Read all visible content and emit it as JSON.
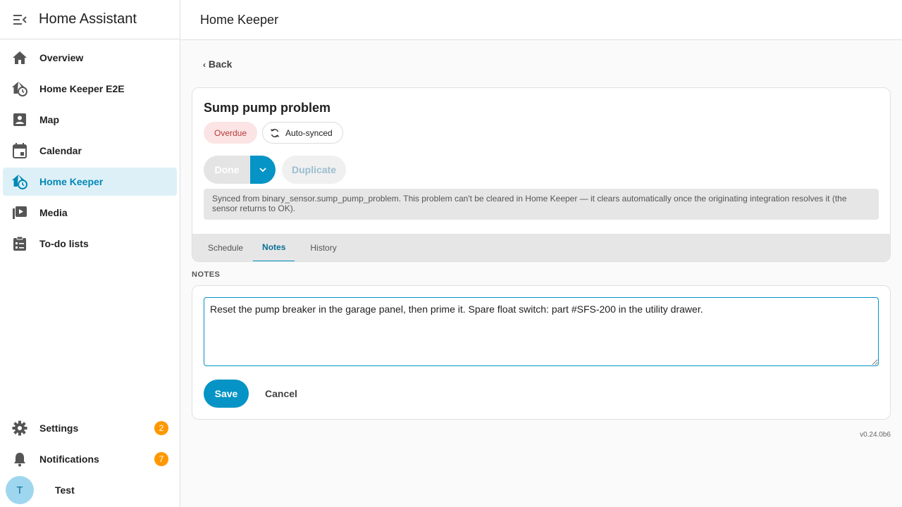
{
  "app": {
    "title": "Home Assistant"
  },
  "sidebar": {
    "items": [
      {
        "label": "Overview",
        "icon": "home-icon"
      },
      {
        "label": "Home Keeper E2E",
        "icon": "home-clock-icon"
      },
      {
        "label": "Map",
        "icon": "account-box-icon"
      },
      {
        "label": "Calendar",
        "icon": "calendar-icon"
      },
      {
        "label": "Home Keeper",
        "icon": "home-clock-icon",
        "active": true
      },
      {
        "label": "Media",
        "icon": "play-box-multiple-icon"
      },
      {
        "label": "To-do lists",
        "icon": "clipboard-list-icon"
      }
    ],
    "settings": {
      "label": "Settings",
      "badge": "2"
    },
    "notifications": {
      "label": "Notifications",
      "badge": "7"
    },
    "user": {
      "initial": "T",
      "name": "Test"
    }
  },
  "header": {
    "title": "Home Keeper"
  },
  "main": {
    "back_label": "Back",
    "task": {
      "title": "Sump pump problem",
      "status_chip": "Overdue",
      "sync_chip": "Auto-synced",
      "done_label": "Done",
      "duplicate_label": "Duplicate",
      "synced_note": "Synced from binary_sensor.sump_pump_problem. This problem can't be cleared in Home Keeper — it clears automatically once the originating integration resolves it (the sensor returns to OK)."
    },
    "tabs": [
      {
        "label": "Schedule"
      },
      {
        "label": "Notes",
        "active": true
      },
      {
        "label": "History"
      }
    ],
    "notes": {
      "section_label": "NOTES",
      "value": "Reset the pump breaker in the garage panel, then prime it. Spare float switch: part #SFS-200 in the utility drawer.",
      "save_label": "Save",
      "cancel_label": "Cancel"
    },
    "version": "v0.24.0b6"
  },
  "colors": {
    "accent": "#0594c5",
    "active_bg": "#def0f7",
    "badge": "#ff9800",
    "overdue_bg": "#fce4e4",
    "overdue_text": "#b33a3a"
  }
}
